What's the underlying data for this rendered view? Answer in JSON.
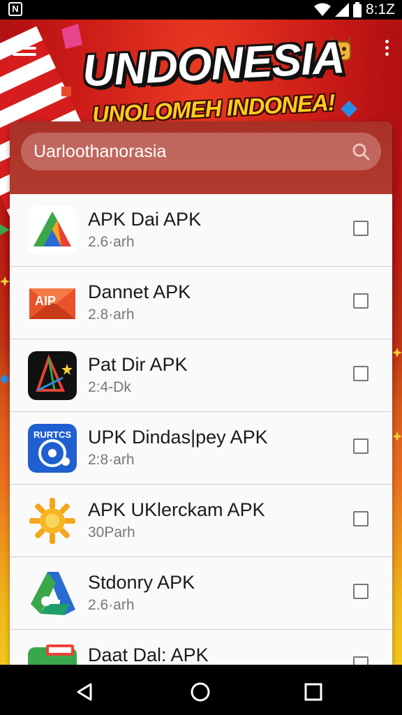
{
  "status_bar": {
    "time": "8:1Z",
    "left_icon_glyph": "N"
  },
  "header": {
    "title": "UNDONESIA",
    "subtitle": "UNOLOMEH INDONEA!"
  },
  "search": {
    "value": "Uarloothanorasia"
  },
  "apps": [
    {
      "name": "APK Dai APK",
      "size": "2.6·arh",
      "icon": "triangle-drive-icon"
    },
    {
      "name": "Dannet APK",
      "size": "2.8·arh",
      "icon": "aip-mail-icon"
    },
    {
      "name": "Pat Dir APK",
      "size": "2:4-Dk",
      "icon": "triangle-star-icon"
    },
    {
      "name": "UPK Dindas|pey APK",
      "size": "2:8·arh",
      "icon": "rurtcs-icon"
    },
    {
      "name": "APK UKlerckam APK",
      "size": "30Parh",
      "icon": "sun-gear-icon"
    },
    {
      "name": "Stdonry APK",
      "size": "2.6·arh",
      "icon": "drive-key-icon"
    },
    {
      "name": "Daat Dal: APK",
      "size": "",
      "icon": "card-icon"
    }
  ],
  "colors": {
    "accent_red": "#c91a17",
    "accent_yellow": "#f3c71f",
    "list_bg": "#fafafa"
  }
}
